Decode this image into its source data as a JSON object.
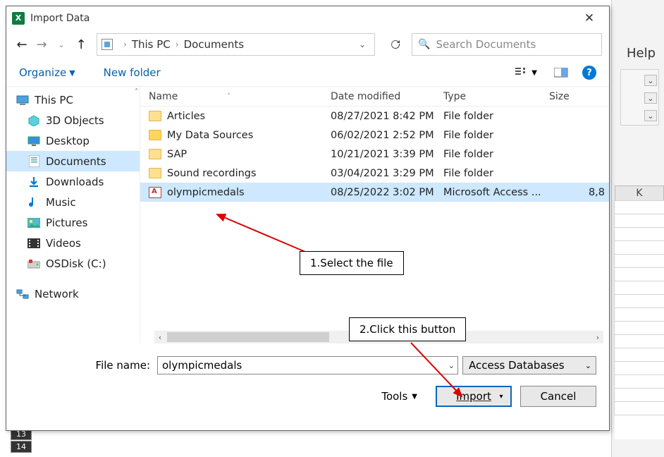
{
  "excel": {
    "help": "Help",
    "column_k": "K",
    "rows": [
      "13",
      "14"
    ]
  },
  "dialog": {
    "title": "Import Data",
    "breadcrumb": {
      "root": "This PC",
      "current": "Documents"
    },
    "search_placeholder": "Search Documents",
    "organize": "Organize",
    "new_folder": "New folder",
    "columns": {
      "name": "Name",
      "date": "Date modified",
      "type": "Type",
      "size": "Size"
    },
    "tree": [
      {
        "label": "This PC",
        "icon": "pc",
        "root": true
      },
      {
        "label": "3D Objects",
        "icon": "3d"
      },
      {
        "label": "Desktop",
        "icon": "desktop"
      },
      {
        "label": "Documents",
        "icon": "doc",
        "selected": true
      },
      {
        "label": "Downloads",
        "icon": "dl"
      },
      {
        "label": "Music",
        "icon": "music"
      },
      {
        "label": "Pictures",
        "icon": "pic"
      },
      {
        "label": "Videos",
        "icon": "vid"
      },
      {
        "label": "OSDisk (C:)",
        "icon": "disk"
      },
      {
        "label": "Network",
        "icon": "net",
        "root": true,
        "gap": true
      }
    ],
    "files": [
      {
        "name": "Articles",
        "date": "08/27/2021 8:42 PM",
        "type": "File folder",
        "size": "",
        "icon": "folder"
      },
      {
        "name": "My Data Sources",
        "date": "06/02/2021 2:52 PM",
        "type": "File folder",
        "size": "",
        "icon": "folder-special"
      },
      {
        "name": "SAP",
        "date": "10/21/2021 3:39 PM",
        "type": "File folder",
        "size": "",
        "icon": "folder"
      },
      {
        "name": "Sound recordings",
        "date": "03/04/2021 3:29 PM",
        "type": "File folder",
        "size": "",
        "icon": "folder"
      },
      {
        "name": "olympicmedals",
        "date": "08/25/2022 3:02 PM",
        "type": "Microsoft Access ...",
        "size": "8,8",
        "icon": "db",
        "selected": true
      }
    ],
    "filename_label": "File name:",
    "filename_value": "olympicmedals",
    "filter": "Access Databases",
    "tools": "Tools",
    "import": "Import",
    "cancel": "Cancel"
  },
  "annotations": {
    "a1": "1.Select the file",
    "a2": "2.Click this button"
  }
}
